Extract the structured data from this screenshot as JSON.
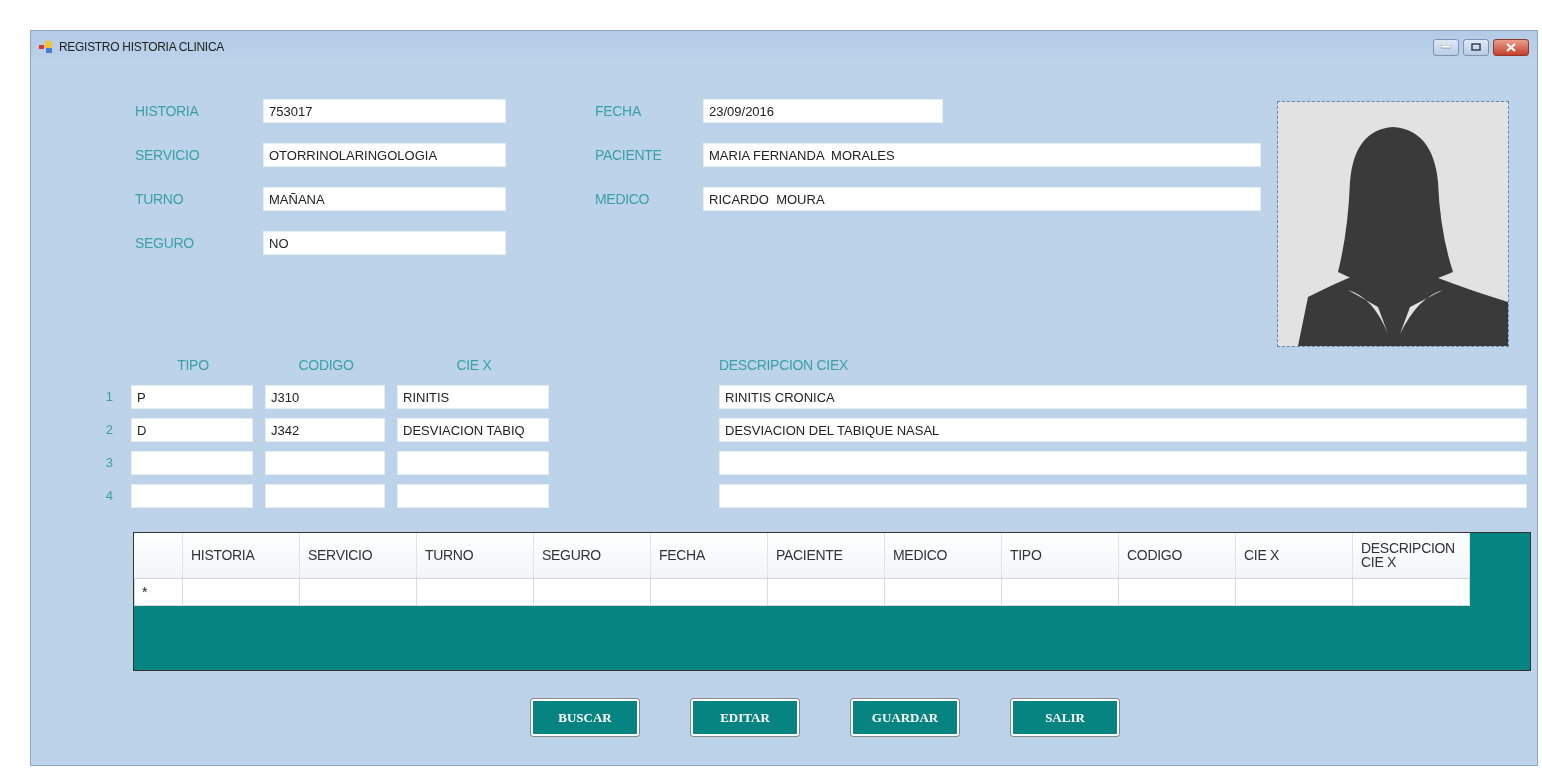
{
  "window": {
    "title": "REGISTRO HISTORIA CLINICA"
  },
  "left_fields": [
    {
      "label": "HISTORIA",
      "value": "753017"
    },
    {
      "label": "SERVICIO",
      "value": "OTORRINOLARINGOLOGIA"
    },
    {
      "label": "TURNO",
      "value": "MAÑANA"
    },
    {
      "label": "SEGURO",
      "value": "NO"
    }
  ],
  "right_fields": [
    {
      "label": "FECHA",
      "value": "23/09/2016",
      "kind": "short"
    },
    {
      "label": "PACIENTE",
      "value": "MARIA FERNANDA  MORALES",
      "kind": "long"
    },
    {
      "label": "MEDICO",
      "value": "RICARDO  MOURA",
      "kind": "long"
    }
  ],
  "diagnoses": {
    "columns": [
      "TIPO",
      "CODIGO",
      "CIE X",
      "DESCRIPCION CIEX"
    ],
    "rows": [
      {
        "number": "1",
        "tipo": "P",
        "codigo": "J310",
        "ciex": "RINITIS",
        "descripcion": "RINITIS CRONICA"
      },
      {
        "number": "2",
        "tipo": "D",
        "codigo": "J342",
        "ciex": "DESVIACION TABIQ",
        "descripcion": "DESVIACION DEL TABIQUE NASAL"
      },
      {
        "number": "3"
      },
      {
        "number": "4"
      }
    ]
  },
  "table": {
    "columns": [
      "HISTORIA",
      "SERVICIO",
      "TURNO",
      "SEGURO",
      "FECHA",
      "PACIENTE",
      "MEDICO",
      "TIPO",
      "CODIGO",
      "CIE X",
      "DESCRIPCION CIE X"
    ],
    "new_row_marker": "*"
  },
  "buttons": [
    "BUSCAR",
    "EDITAR",
    "GUARDAR",
    "SALIR"
  ]
}
